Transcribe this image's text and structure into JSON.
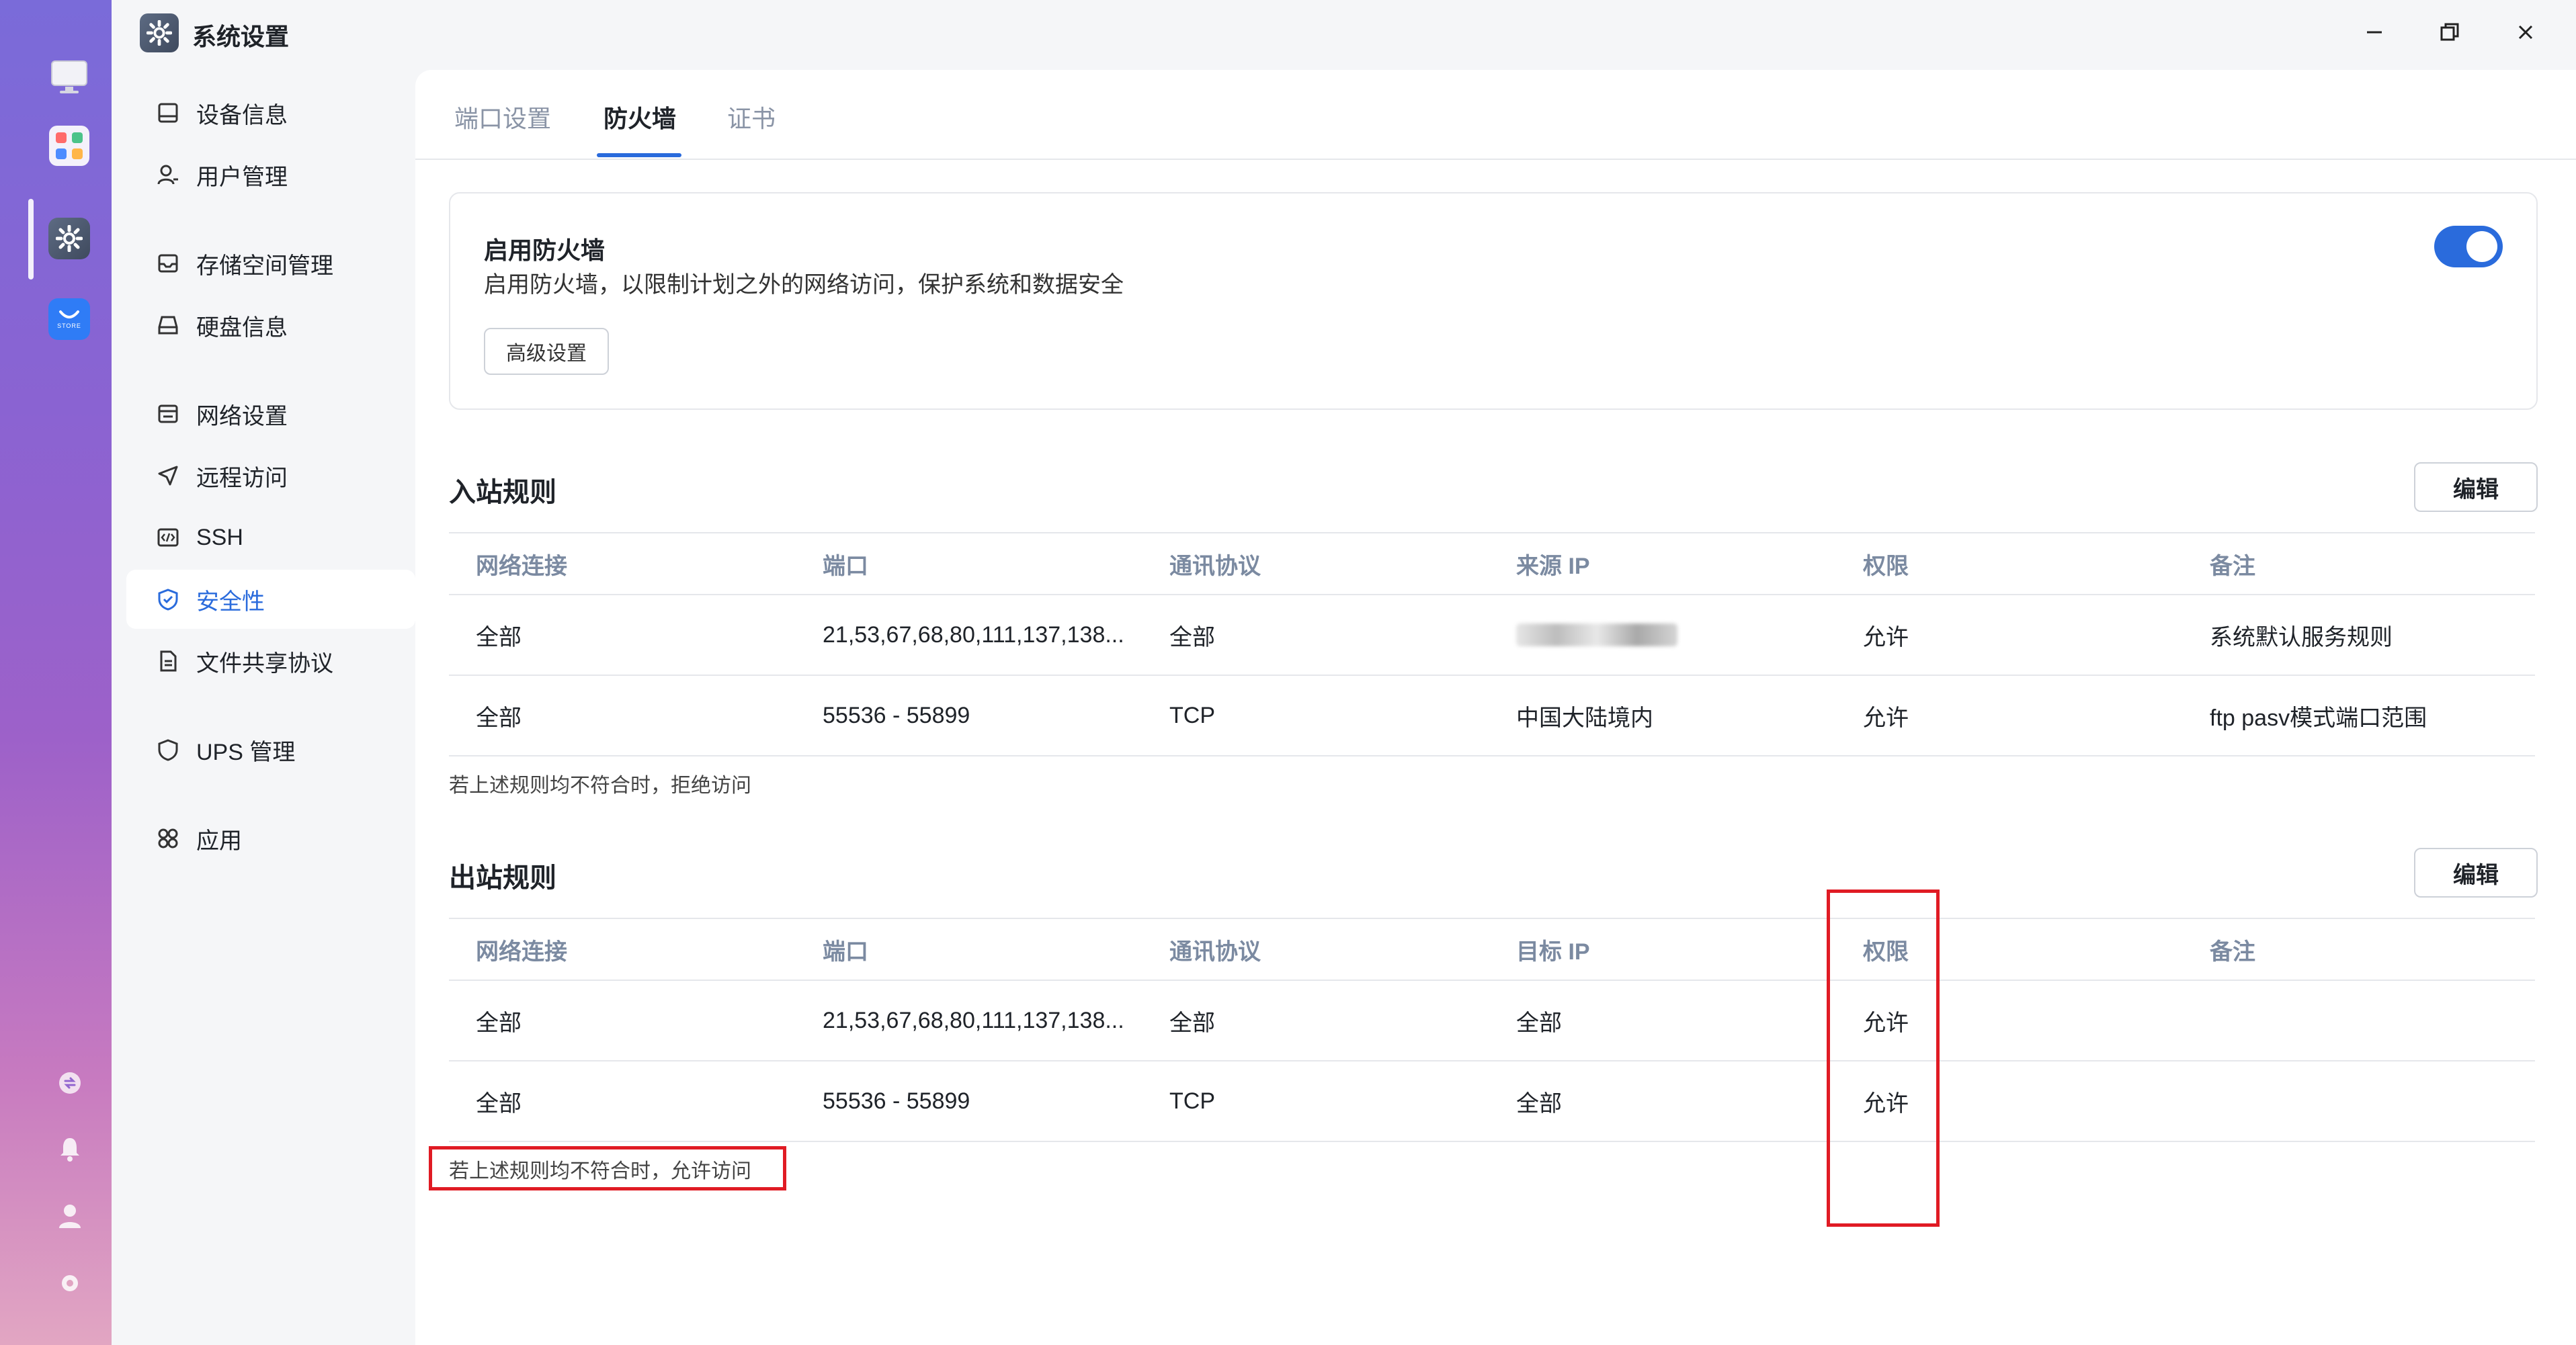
{
  "window": {
    "title": "系统设置"
  },
  "dock": {
    "items": [
      "monitor-icon",
      "apps-grid-icon",
      "settings-icon",
      "store-icon"
    ],
    "store_label": "STORE",
    "bottom": [
      "sync-icon",
      "bell-icon",
      "user-icon",
      "settings-small-icon"
    ]
  },
  "sidebar": {
    "items": [
      {
        "label": "设备信息",
        "icon": "device-icon"
      },
      {
        "label": "用户管理",
        "icon": "user-icon"
      },
      {
        "label": "存储空间管理",
        "icon": "storage-icon"
      },
      {
        "label": "硬盘信息",
        "icon": "disk-icon"
      },
      {
        "label": "网络设置",
        "icon": "network-icon"
      },
      {
        "label": "远程访问",
        "icon": "send-icon"
      },
      {
        "label": "SSH",
        "icon": "code-icon"
      },
      {
        "label": "安全性",
        "icon": "shield-icon",
        "active": true
      },
      {
        "label": "文件共享协议",
        "icon": "file-icon"
      },
      {
        "label": "UPS 管理",
        "icon": "ups-shield-icon"
      },
      {
        "label": "应用",
        "icon": "apps-icon"
      }
    ]
  },
  "tabs": [
    {
      "label": "端口设置"
    },
    {
      "label": "防火墙",
      "active": true
    },
    {
      "label": "证书"
    }
  ],
  "firewall": {
    "title": "启用防火墙",
    "description": "启用防火墙，以限制计划之外的网络访问，保护系统和数据安全",
    "advanced_button": "高级设置",
    "enabled": true
  },
  "inbound": {
    "title": "入站规则",
    "edit_button": "编辑",
    "headers": [
      "网络连接",
      "端口",
      "通讯协议",
      "来源 IP",
      "权限",
      "备注"
    ],
    "rows": [
      [
        "全部",
        "21,53,67,68,80,111,137,138...",
        "全部",
        "",
        "允许",
        "系统默认服务规则"
      ],
      [
        "全部",
        "55536 - 55899",
        "TCP",
        "中国大陆境内",
        "允许",
        "ftp pasv模式端口范围"
      ]
    ],
    "footnote": "若上述规则均不符合时，拒绝访问"
  },
  "outbound": {
    "title": "出站规则",
    "edit_button": "编辑",
    "headers": [
      "网络连接",
      "端口",
      "通讯协议",
      "目标 IP",
      "权限",
      "备注"
    ],
    "rows": [
      [
        "全部",
        "21,53,67,68,80,111,137,138...",
        "全部",
        "全部",
        "允许",
        ""
      ],
      [
        "全部",
        "55536 - 55899",
        "TCP",
        "全部",
        "允许",
        ""
      ]
    ],
    "footnote": "若上述规则均不符合时，允许访问"
  },
  "colors": {
    "accent": "#2a6bdc",
    "highlight": "#e01b24"
  }
}
